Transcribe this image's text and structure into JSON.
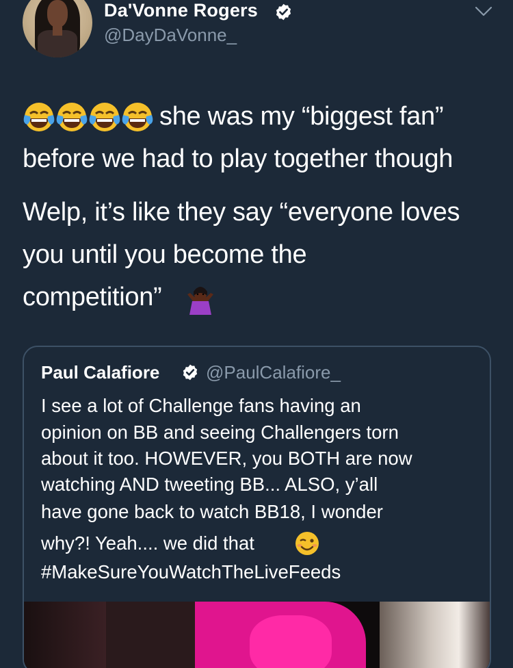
{
  "tweet": {
    "author_name": "Da'Vonne Rogers",
    "author_handle": "@DayDaVonne_",
    "lines": [
      "she was my “biggest fan”",
      "before we had to play together though",
      "Welp, it’s like they say “everyone loves",
      "you until you become the",
      "competition”"
    ],
    "emoji_lead": [
      "face-with-tears-of-joy-icon",
      "face-with-tears-of-joy-icon",
      "face-with-tears-of-joy-icon",
      "face-with-tears-of-joy-icon"
    ],
    "emoji_trail": "person-shrugging-icon"
  },
  "quote": {
    "author_name": "Paul Calafiore",
    "author_handle": "@PaulCalafiore_",
    "lines": [
      "I see a lot of Challenge fans having an",
      "opinion on BB and seeing Challengers torn",
      "about it too. HOWEVER, you BOTH are now",
      "watching AND tweeting BB... ALSO, y’all",
      "have gone back to watch BB18, I wonder",
      "why?! Yeah.... we did that",
      "#MakeSureYouWatchTheLiveFeeds"
    ],
    "emoji_inline": "winking-face-icon"
  },
  "colors": {
    "background": "#1c2938",
    "text": "#ffffff",
    "secondary_text": "#8a9aab",
    "border": "#3d5166",
    "verified_badge": "#ffffff"
  }
}
